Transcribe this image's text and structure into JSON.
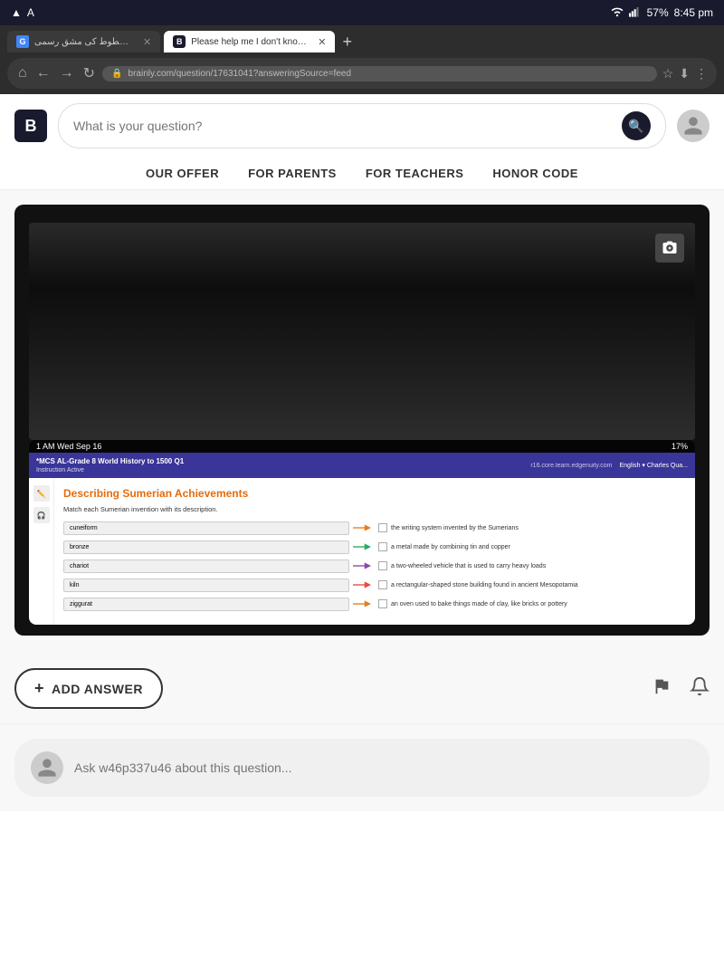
{
  "statusBar": {
    "leftIcons": "▲ A",
    "wifi": "WiFi",
    "signal": "▄▅▆",
    "battery": "57%",
    "time": "8:45 pm"
  },
  "tabs": [
    {
      "id": "tab1",
      "favicon": "G",
      "label": "مین خطوط کی مشق رسمی –",
      "active": false
    },
    {
      "id": "tab2",
      "favicon": "B",
      "label": "Please help me I don't know...",
      "active": true
    }
  ],
  "addressBar": {
    "url": "brainly.com/question/17631041?answeringSource=feed"
  },
  "header": {
    "logoText": "B",
    "searchPlaceholder": "What is your question?",
    "navItems": [
      {
        "label": "OUR OFFER"
      },
      {
        "label": "FOR PARENTS"
      },
      {
        "label": "FOR TEACHERS"
      },
      {
        "label": "HONOR CODE"
      }
    ]
  },
  "questionImage": {
    "innerScreenshot": {
      "statusBar": "1 AM  Wed Sep 16",
      "url": "r16.core.learn.edgenuity.com",
      "batteryText": "17%",
      "appTitle": "*MCS AL-Grade 8 World History to 1500 Q1",
      "rightControls": "English ▾  Charles Qua...",
      "activityTitle": "Describing Sumerian Achievements",
      "instructions": "Match each Sumerian invention with its description.",
      "matchItems": [
        {
          "term": "cuneiform",
          "description": "the writing system invented by the Sumerians",
          "arrowColor": "#e67e22"
        },
        {
          "term": "bronze",
          "description": "a metal made by combining tin and copper",
          "arrowColor": "#27ae60"
        },
        {
          "term": "chariot",
          "description": "a two-wheeled vehicle that is used to carry heavy loads",
          "arrowColor": "#8e44ad"
        },
        {
          "term": "kiln",
          "description": "a rectangular-shaped stone building found in ancient Mesopotamia",
          "arrowColor": "#e74c3c"
        },
        {
          "term": "ziggurat",
          "description": "an oven used to bake things made of clay, like bricks or pottery",
          "arrowColor": "#e67e22"
        }
      ]
    }
  },
  "addAnswerButton": {
    "plusLabel": "+",
    "label": "ADD ANSWER"
  },
  "commentBox": {
    "placeholder": "Ask w46p337u46 about this question..."
  }
}
